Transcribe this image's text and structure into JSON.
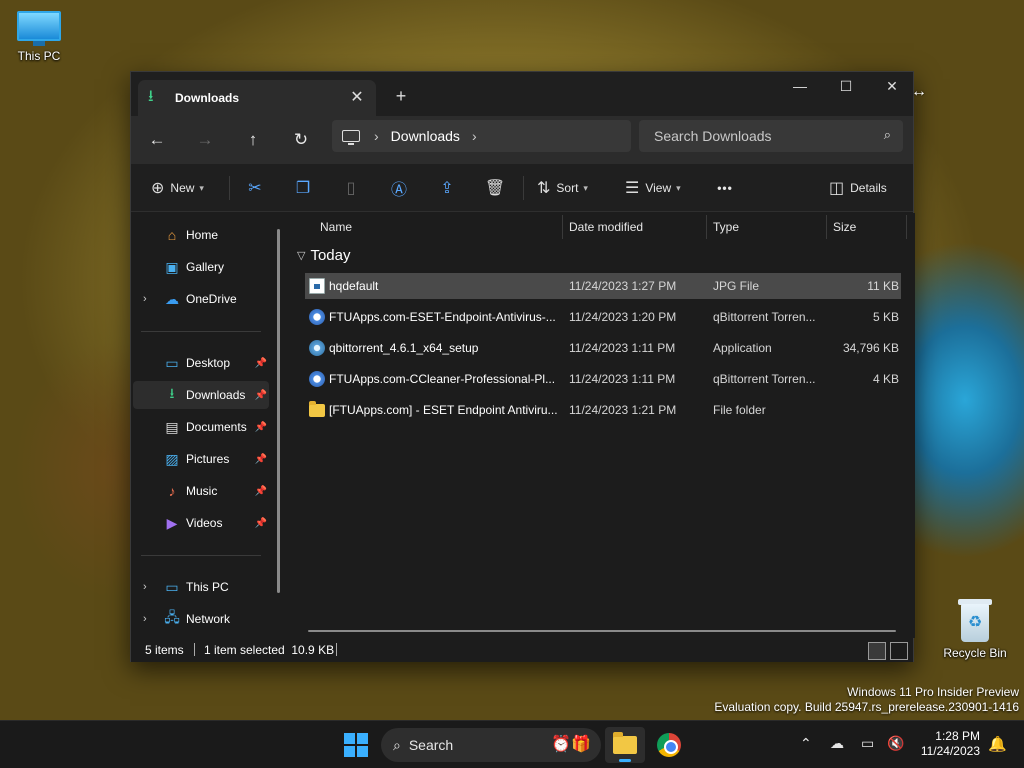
{
  "desktop": {
    "icons": [
      {
        "label": "This PC"
      },
      {
        "label": "Recycle Bin"
      }
    ],
    "watermark": {
      "line1": "Windows 11 Pro Insider Preview",
      "line2": "Evaluation copy. Build 25947.rs_prerelease.230901-1416"
    }
  },
  "window": {
    "tab": {
      "title": "Downloads",
      "close_label": "✕"
    },
    "new_tab_label": "+",
    "controls": {
      "minimize": "—",
      "maximize": "☐",
      "close": "✕"
    },
    "nav": {
      "back": "←",
      "forward": "→",
      "up": "↑",
      "refresh": "↻"
    },
    "address": {
      "segment": "Downloads",
      "sep": "›"
    },
    "search": {
      "placeholder": "Search Downloads"
    },
    "toolbar": {
      "new_label": "New",
      "sort_label": "Sort",
      "view_label": "View",
      "more_label": "•••",
      "details_label": "Details"
    },
    "sidebar": {
      "items": [
        {
          "label": "Home",
          "icon": "home-icon"
        },
        {
          "label": "Gallery",
          "icon": "gallery-icon"
        },
        {
          "label": "OneDrive",
          "icon": "onedrive-icon"
        },
        {
          "label": "Desktop",
          "icon": "desktop-icon"
        },
        {
          "label": "Downloads",
          "icon": "downloads-icon",
          "selected": true
        },
        {
          "label": "Documents",
          "icon": "documents-icon"
        },
        {
          "label": "Pictures",
          "icon": "pictures-icon"
        },
        {
          "label": "Music",
          "icon": "music-icon"
        },
        {
          "label": "Videos",
          "icon": "videos-icon"
        },
        {
          "label": "This PC",
          "icon": "this-pc-icon"
        },
        {
          "label": "Network",
          "icon": "network-icon"
        }
      ]
    },
    "columns": {
      "name": "Name",
      "date": "Date modified",
      "type": "Type",
      "size": "Size"
    },
    "group": {
      "label": "Today"
    },
    "files": [
      {
        "name": "hqdefault",
        "date": "11/24/2023 1:27 PM",
        "type": "JPG File",
        "size": "11 KB",
        "icon": "jpg-file-icon",
        "selected": true
      },
      {
        "name": "FTUApps.com-ESET-Endpoint-Antivirus-...",
        "date": "11/24/2023 1:20 PM",
        "type": "qBittorrent Torren...",
        "size": "5 KB",
        "icon": "torrent-file-icon"
      },
      {
        "name": "qbittorrent_4.6.1_x64_setup",
        "date": "11/24/2023 1:11 PM",
        "type": "Application",
        "size": "34,796 KB",
        "icon": "application-icon"
      },
      {
        "name": "FTUApps.com-CCleaner-Professional-Pl...",
        "date": "11/24/2023 1:11 PM",
        "type": "qBittorrent Torren...",
        "size": "4 KB",
        "icon": "torrent-file-icon"
      },
      {
        "name": "[FTUApps.com] - ESET Endpoint Antiviru...",
        "date": "11/24/2023 1:21 PM",
        "type": "File folder",
        "size": "",
        "icon": "folder-icon"
      }
    ],
    "status": {
      "count": "5 items",
      "selection": "1 item selected  10.9 KB"
    }
  },
  "taskbar": {
    "search_label": "Search",
    "clock": {
      "time": "1:28 PM",
      "date": "11/24/2023"
    }
  },
  "colors": {
    "accent": "#3ab0ff",
    "window_bg": "#1c1c1c",
    "selection": "#4a4a4a"
  }
}
